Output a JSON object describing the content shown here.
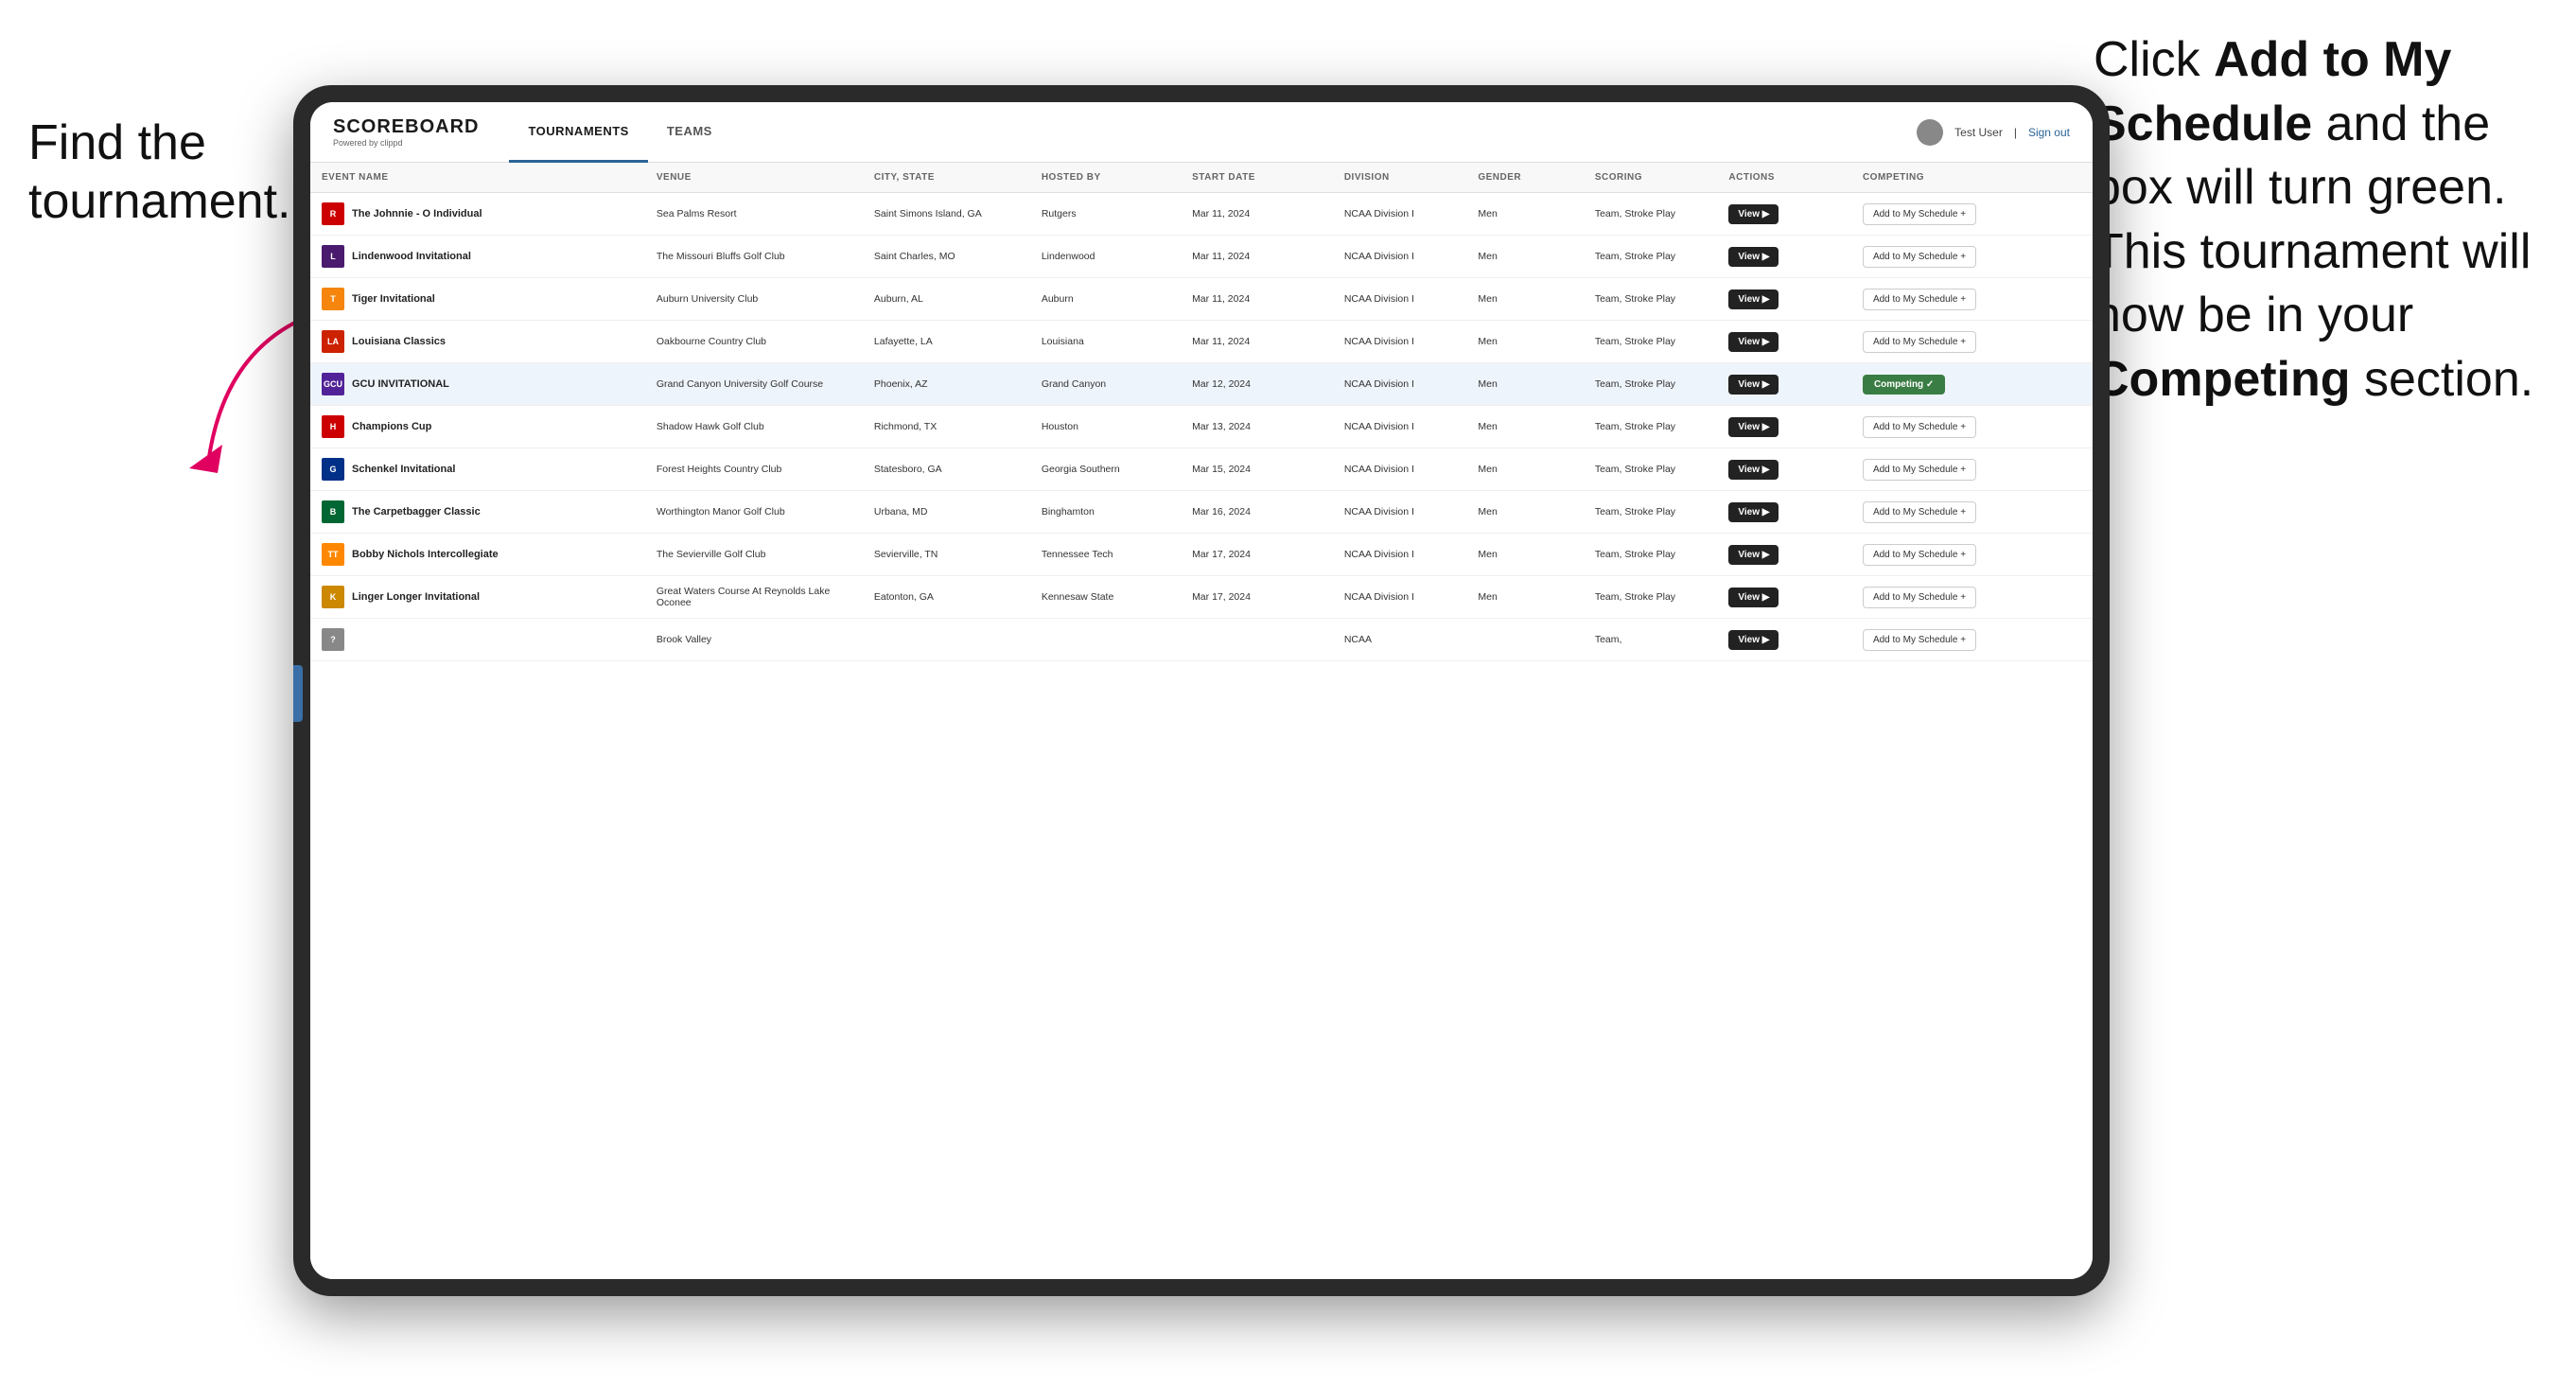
{
  "annotation": {
    "left": "Find the tournament.",
    "right_line1": "Click ",
    "right_bold1": "Add to My Schedule",
    "right_line2": " and the box will turn green. This tournament will now be in your ",
    "right_bold2": "Competing",
    "right_line3": " section."
  },
  "app": {
    "logo": "SCOREBOARD",
    "logo_sub": "Powered by clippd",
    "nav": {
      "tabs": [
        "TOURNAMENTS",
        "TEAMS"
      ],
      "active": "TOURNAMENTS"
    },
    "user": "Test User",
    "signout": "Sign out"
  },
  "table": {
    "columns": [
      "EVENT NAME",
      "VENUE",
      "CITY, STATE",
      "HOSTED BY",
      "START DATE",
      "DIVISION",
      "GENDER",
      "SCORING",
      "ACTIONS",
      "COMPETING"
    ],
    "rows": [
      {
        "logo_color": "#cc0000",
        "logo_letter": "R",
        "event": "The Johnnie - O Individual",
        "venue": "Sea Palms Resort",
        "city": "Saint Simons Island, GA",
        "hosted": "Rutgers",
        "date": "Mar 11, 2024",
        "division": "NCAA Division I",
        "gender": "Men",
        "scoring": "Team, Stroke Play",
        "competing_state": "add",
        "competing_label": "Add to My Schedule +"
      },
      {
        "logo_color": "#4a1a6e",
        "logo_letter": "L",
        "event": "Lindenwood Invitational",
        "venue": "The Missouri Bluffs Golf Club",
        "city": "Saint Charles, MO",
        "hosted": "Lindenwood",
        "date": "Mar 11, 2024",
        "division": "NCAA Division I",
        "gender": "Men",
        "scoring": "Team, Stroke Play",
        "competing_state": "add",
        "competing_label": "Add to My Schedule +"
      },
      {
        "logo_color": "#0033a0",
        "logo_letter": "T",
        "event": "Tiger Invitational",
        "venue": "Auburn University Club",
        "city": "Auburn, AL",
        "hosted": "Auburn",
        "date": "Mar 11, 2024",
        "division": "NCAA Division I",
        "gender": "Men",
        "scoring": "Team, Stroke Play",
        "competing_state": "add",
        "competing_label": "Add to My Schedule +"
      },
      {
        "logo_color": "#cc2200",
        "logo_letter": "LA",
        "event": "Louisiana Classics",
        "venue": "Oakbourne Country Club",
        "city": "Lafayette, LA",
        "hosted": "Louisiana",
        "date": "Mar 11, 2024",
        "division": "NCAA Division I",
        "gender": "Men",
        "scoring": "Team, Stroke Play",
        "competing_state": "add",
        "competing_label": "Add to My Schedule +"
      },
      {
        "logo_color": "#522398",
        "logo_letter": "GCU",
        "event": "GCU INVITATIONAL",
        "venue": "Grand Canyon University Golf Course",
        "city": "Phoenix, AZ",
        "hosted": "Grand Canyon",
        "date": "Mar 12, 2024",
        "division": "NCAA Division I",
        "gender": "Men",
        "scoring": "Team, Stroke Play",
        "competing_state": "competing",
        "competing_label": "Competing ✓",
        "highlighted": true
      },
      {
        "logo_color": "#cc0000",
        "logo_letter": "H",
        "event": "Champions Cup",
        "venue": "Shadow Hawk Golf Club",
        "city": "Richmond, TX",
        "hosted": "Houston",
        "date": "Mar 13, 2024",
        "division": "NCAA Division I",
        "gender": "Men",
        "scoring": "Team, Stroke Play",
        "competing_state": "add",
        "competing_label": "Add to My Schedule +"
      },
      {
        "logo_color": "#003087",
        "logo_letter": "G",
        "event": "Schenkel Invitational",
        "venue": "Forest Heights Country Club",
        "city": "Statesboro, GA",
        "hosted": "Georgia Southern",
        "date": "Mar 15, 2024",
        "division": "NCAA Division I",
        "gender": "Men",
        "scoring": "Team, Stroke Play",
        "competing_state": "add",
        "competing_label": "Add to My Schedule +"
      },
      {
        "logo_color": "#006633",
        "logo_letter": "B",
        "event": "The Carpetbagger Classic",
        "venue": "Worthington Manor Golf Club",
        "city": "Urbana, MD",
        "hosted": "Binghamton",
        "date": "Mar 16, 2024",
        "division": "NCAA Division I",
        "gender": "Men",
        "scoring": "Team, Stroke Play",
        "competing_state": "add",
        "competing_label": "Add to My Schedule +"
      },
      {
        "logo_color": "#ff8800",
        "logo_letter": "TT",
        "event": "Bobby Nichols Intercollegiate",
        "venue": "The Sevierville Golf Club",
        "city": "Sevierville, TN",
        "hosted": "Tennessee Tech",
        "date": "Mar 17, 2024",
        "division": "NCAA Division I",
        "gender": "Men",
        "scoring": "Team, Stroke Play",
        "competing_state": "add",
        "competing_label": "Add to My Schedule +"
      },
      {
        "logo_color": "#ffcc00",
        "logo_letter": "K",
        "event": "Linger Longer Invitational",
        "venue": "Great Waters Course At Reynolds Lake Oconee",
        "city": "Eatonton, GA",
        "hosted": "Kennesaw State",
        "date": "Mar 17, 2024",
        "division": "NCAA Division I",
        "gender": "Men",
        "scoring": "Team, Stroke Play",
        "competing_state": "add",
        "competing_label": "Add to My Schedule +"
      },
      {
        "logo_color": "#888",
        "logo_letter": "?",
        "event": "",
        "venue": "Brook Valley",
        "city": "",
        "hosted": "",
        "date": "",
        "division": "NCAA",
        "gender": "",
        "scoring": "Team,",
        "competing_state": "add",
        "competing_label": "Add to My Schedule +"
      }
    ]
  },
  "buttons": {
    "view": "View",
    "add_schedule": "Add to My Schedule +",
    "competing": "Competing ✓"
  },
  "colors": {
    "competing_green": "#3a7d44",
    "view_dark": "#222222",
    "highlight_row": "#eef4fb"
  }
}
